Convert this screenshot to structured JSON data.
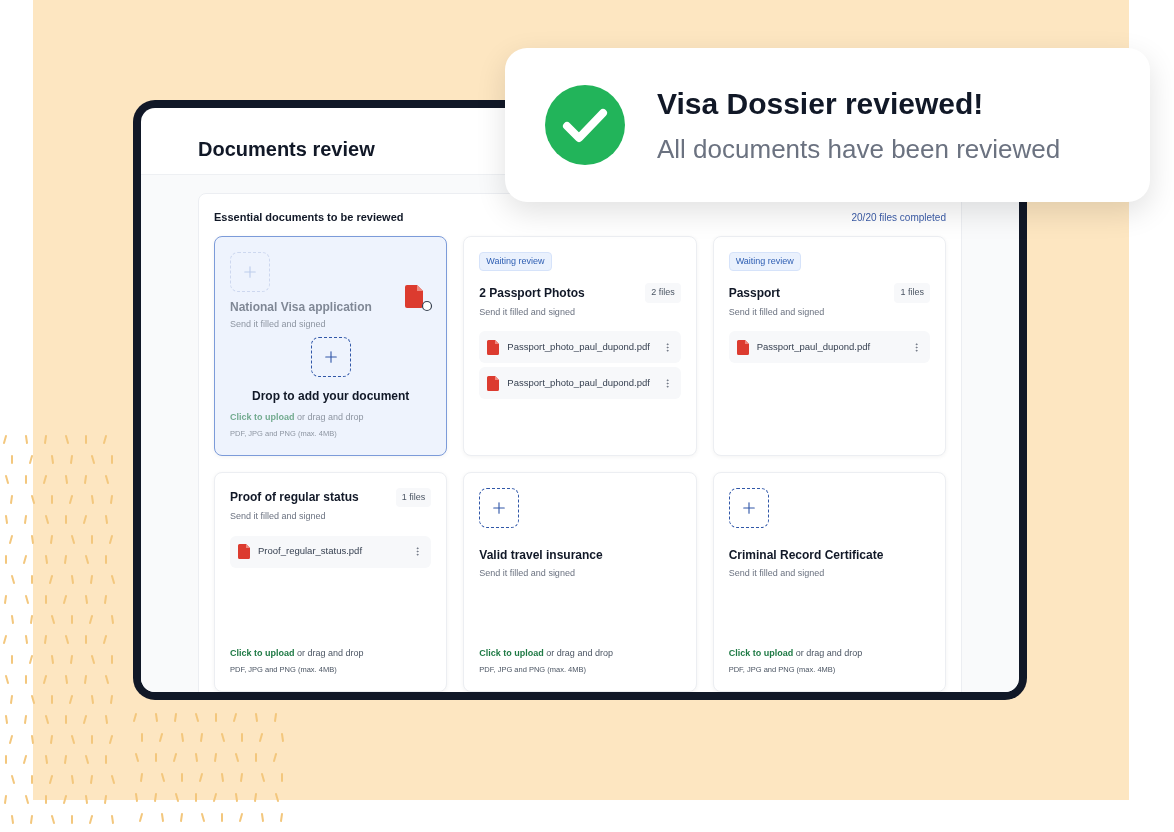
{
  "toast": {
    "title": "Visa Dossier reviewed!",
    "message": "All documents have been reviewed"
  },
  "page": {
    "title": "Documents review"
  },
  "section": {
    "title": "Essential documents to be reviewed",
    "progress": "20/20 files completed"
  },
  "cards": [
    {
      "kind": "dropzone",
      "drag_over": true,
      "title": "National Visa application",
      "subtitle": "Send it filled and signed",
      "drop_label": "Drop to add your document",
      "upload_link": "Click to upload",
      "upload_rest": "or drag and drop",
      "formats": "PDF, JPG and PNG (max. 4MB)"
    },
    {
      "kind": "files",
      "badge": "Waiting review",
      "title": "2 Passport Photos",
      "count": "2 files",
      "subtitle": "Send it filled and signed",
      "files": [
        "Passport_photo_paul_dupond.pdf",
        "Passport_photo_paul_dupond.pdf"
      ]
    },
    {
      "kind": "files",
      "badge": "Waiting review",
      "title": "Passport",
      "count": "1 files",
      "subtitle": "Send it filled and signed",
      "files": [
        "Passport_paul_dupond.pdf"
      ]
    },
    {
      "kind": "files",
      "title": "Proof of regular status",
      "count": "1 files",
      "subtitle": "Send it filled and signed",
      "files": [
        "Proof_regular_status.pdf"
      ],
      "upload_link": "Click to upload",
      "upload_rest": "or drag and drop",
      "formats": "PDF, JPG and PNG (max. 4MB)"
    },
    {
      "kind": "empty",
      "title": "Valid travel insurance",
      "subtitle": "Send it filled and signed",
      "upload_link": "Click to upload",
      "upload_rest": "or drag and drop",
      "formats": "PDF, JPG and PNG (max. 4MB)"
    },
    {
      "kind": "empty",
      "title": "Criminal Record Certificate",
      "subtitle": "Send it filled and signed",
      "upload_link": "Click to upload",
      "upload_rest": "or drag and drop",
      "formats": "PDF, JPG and PNG (max. 4MB)"
    }
  ]
}
